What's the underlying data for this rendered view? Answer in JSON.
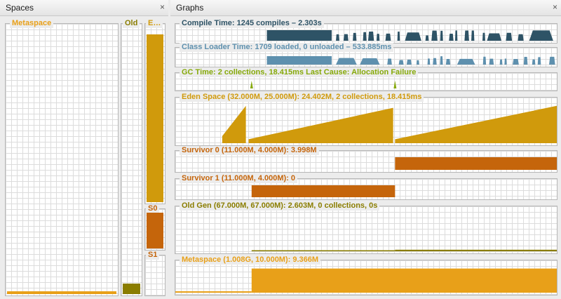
{
  "spaces": {
    "title": "Spaces",
    "close_glyph": "×",
    "metaspace": {
      "label": "Metaspace",
      "color": "#e8a019",
      "fill_fraction": 0.01
    },
    "old": {
      "label": "Old",
      "color": "#8a7d00",
      "fill_fraction": 0.04
    },
    "eden": {
      "label": "E…",
      "color": "#d09a0c",
      "fill_fraction": 0.95
    },
    "s0": {
      "label": "S0",
      "color": "#c5650b",
      "fill_fraction": 0.95
    },
    "s1": {
      "label": "S1",
      "color": "#c5650b",
      "fill_fraction": 0.0
    }
  },
  "graphs": {
    "title": "Graphs",
    "close_glyph": "×",
    "items": [
      {
        "label": "Compile Time: 1245 compiles – 2.303s",
        "color": "#2e5366",
        "kind": "spikes",
        "x_start": 0.24,
        "height": 1.0,
        "seed": 3
      },
      {
        "label": "Class Loader Time: 1709 loaded, 0 unloaded – 533.885ms",
        "color": "#5e90ae",
        "kind": "spikes",
        "x_start": 0.24,
        "height": 0.8,
        "seed": 7
      },
      {
        "label": "GC Time: 2 collections, 18.415ms Last Cause: Allocation Failure",
        "color": "#86a90a",
        "kind": "gc",
        "events": [
          0.2,
          0.576
        ]
      },
      {
        "label": "Eden Space (32.000M, 25.000M): 24.402M, 2 collections, 18.415ms",
        "color": "#d09a0c",
        "kind": "saw",
        "segments": [
          [
            0.123,
            0.185,
            0.18,
            0.95
          ],
          [
            0.192,
            0.571,
            0.1,
            0.9
          ],
          [
            0.576,
            1.0,
            0.1,
            0.95
          ]
        ]
      },
      {
        "label": "Survivor 0 (11.000M, 4.000M): 3.998M",
        "color": "#c5650b",
        "kind": "block",
        "blocks": [
          [
            0.576,
            1.0,
            1.0
          ]
        ]
      },
      {
        "label": "Survivor 1 (11.000M, 4.000M): 0",
        "color": "#c5650b",
        "kind": "block",
        "blocks": [
          [
            0.2,
            0.576,
            1.0
          ]
        ]
      },
      {
        "label": "Old Gen (67.000M, 67.000M): 2.603M, 0 collections, 0s",
        "color": "#8a7d00",
        "kind": "block",
        "blocks": [
          [
            0.2,
            0.576,
            0.02
          ],
          [
            0.576,
            1.0,
            0.04
          ]
        ]
      },
      {
        "label": "Metaspace (1.008G, 10.000M): 9.366M",
        "color": "#e8a019",
        "kind": "metaspace",
        "blocks": [
          [
            0.2,
            1.0,
            0.93
          ]
        ]
      }
    ]
  }
}
